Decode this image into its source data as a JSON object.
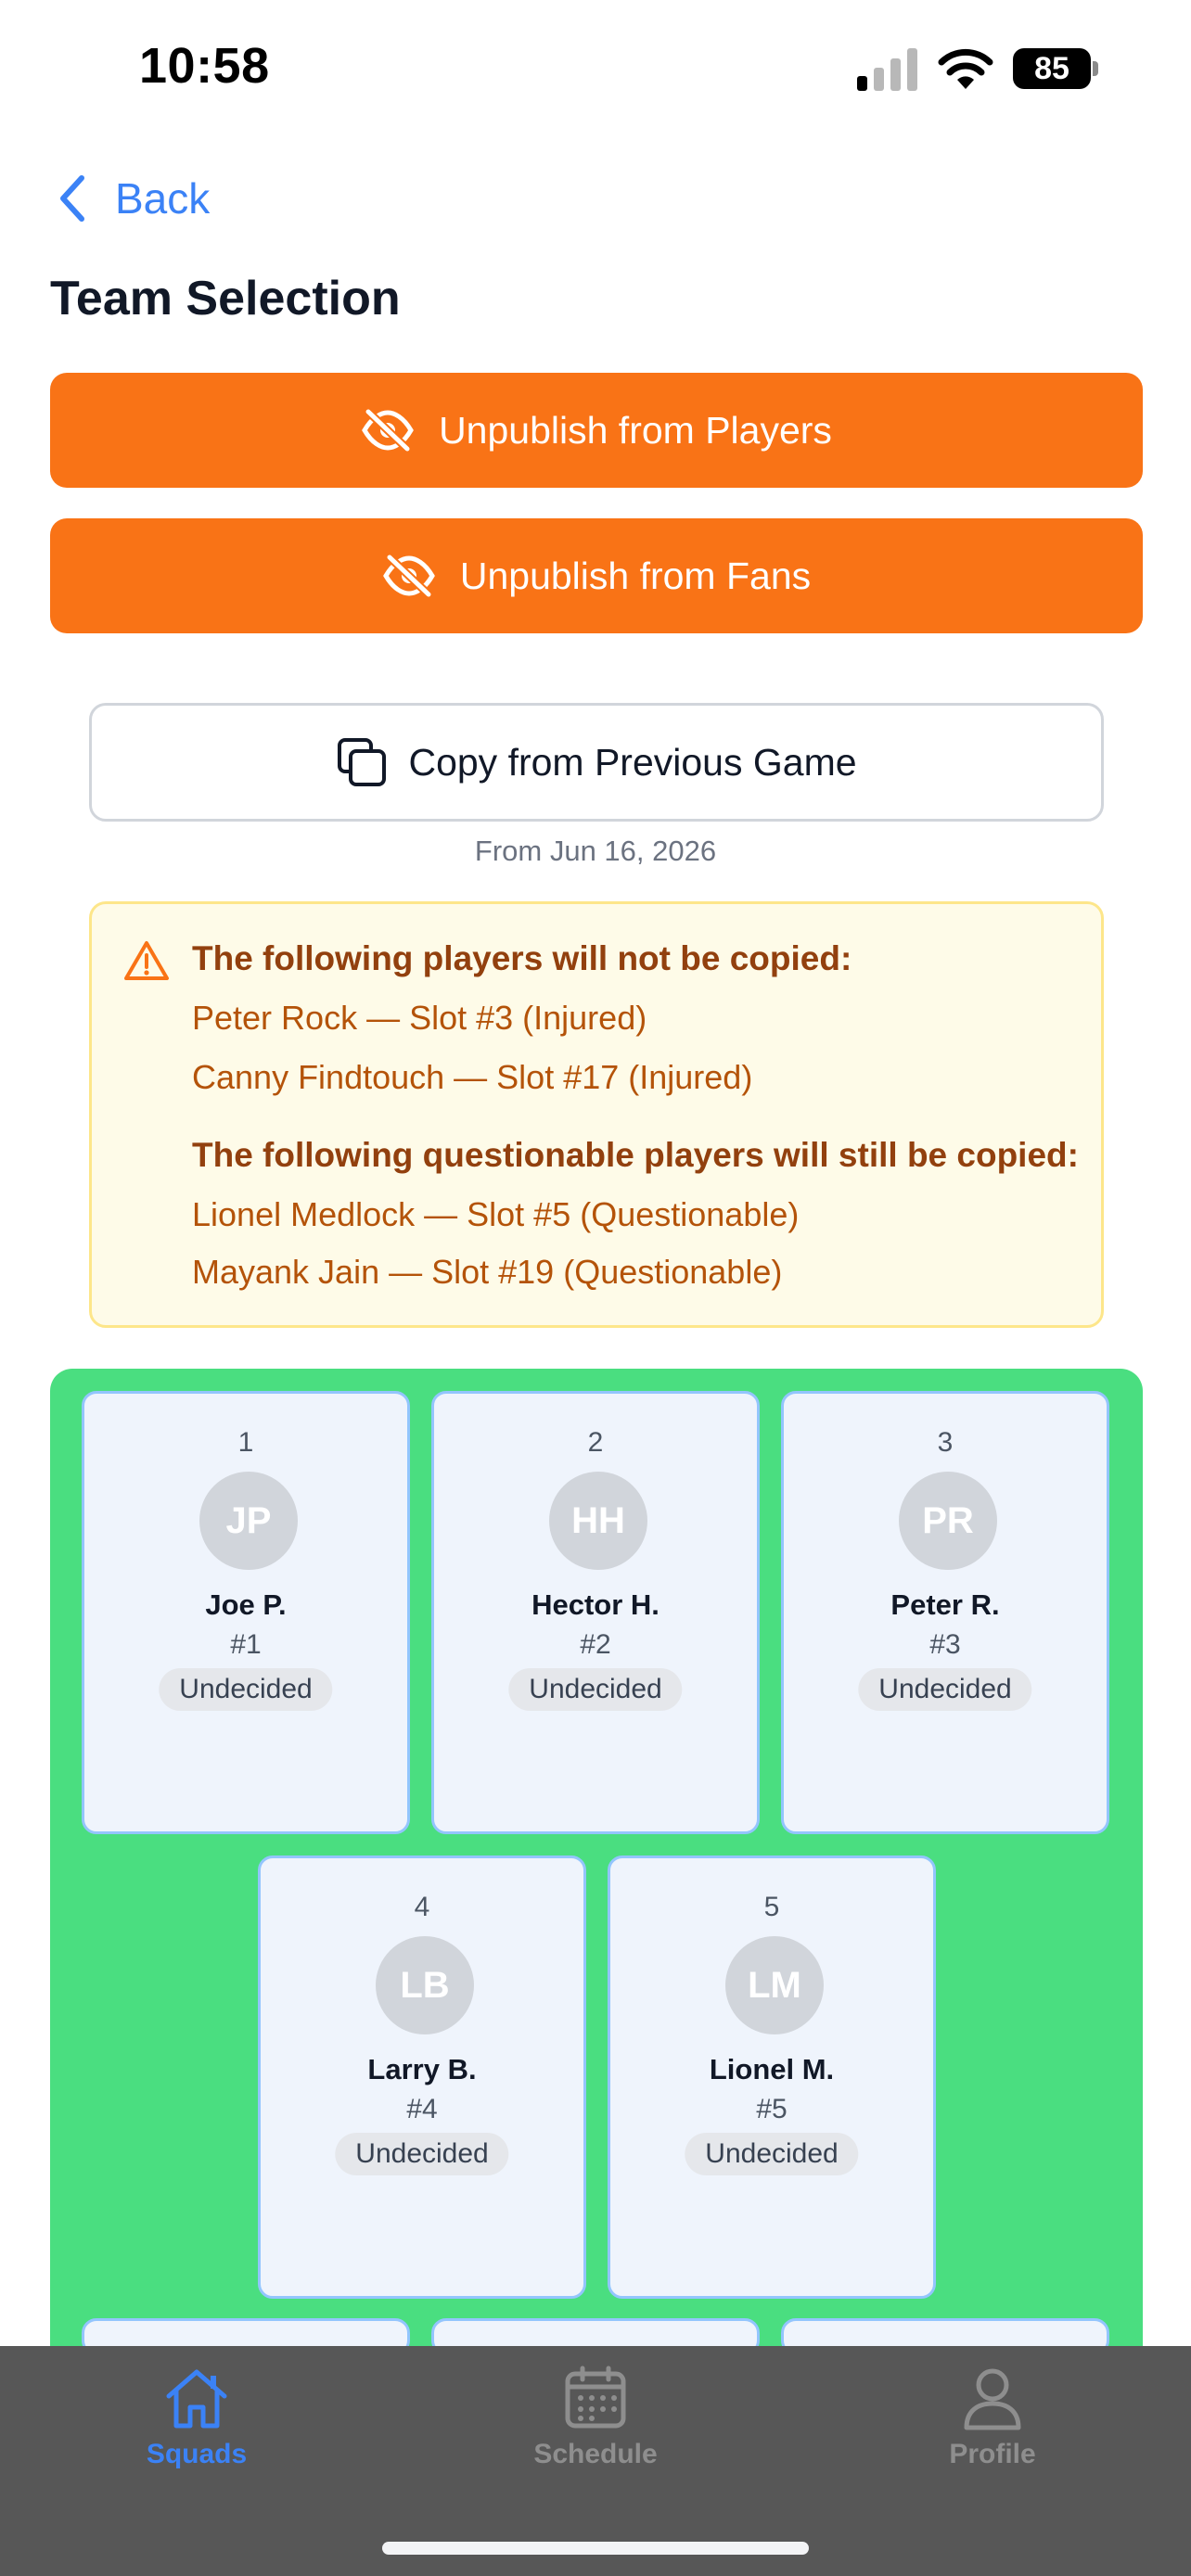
{
  "status_bar": {
    "time": "10:58",
    "battery": "85"
  },
  "header": {
    "back_label": "Back",
    "title": "Team Selection"
  },
  "actions": {
    "unpublish_players": "Unpublish from Players",
    "unpublish_fans": "Unpublish from Fans",
    "copy_previous": "Copy from Previous Game",
    "copy_date": "From Jun 16, 2026"
  },
  "warning": {
    "not_copied_title": "The following players will not be copied:",
    "not_copied": [
      "Peter Rock — Slot #3 (Injured)",
      "Canny Findtouch — Slot #17 (Injured)"
    ],
    "copied_title": "The following questionable players will still be copied:",
    "copied": [
      "Lionel Medlock — Slot #5 (Questionable)",
      "Mayank Jain — Slot #19 (Questionable)"
    ]
  },
  "slots": [
    {
      "slot": "1",
      "initials": "JP",
      "name": "Joe P.",
      "jersey": "#1",
      "status": "Undecided"
    },
    {
      "slot": "2",
      "initials": "HH",
      "name": "Hector H.",
      "jersey": "#2",
      "status": "Undecided"
    },
    {
      "slot": "3",
      "initials": "PR",
      "name": "Peter R.",
      "jersey": "#3",
      "status": "Undecided"
    },
    {
      "slot": "4",
      "initials": "LB",
      "name": "Larry B.",
      "jersey": "#4",
      "status": "Undecided"
    },
    {
      "slot": "5",
      "initials": "LM",
      "name": "Lionel M.",
      "jersey": "#5",
      "status": "Undecided"
    }
  ],
  "tabs": [
    {
      "label": "Squads",
      "icon": "home-icon",
      "active": true
    },
    {
      "label": "Schedule",
      "icon": "calendar-icon",
      "active": false
    },
    {
      "label": "Profile",
      "icon": "person-icon",
      "active": false
    }
  ],
  "colors": {
    "accent": "#3b82f6",
    "primary_button": "#f97316",
    "field": "#4ade80",
    "warning_bg": "#fefbe8"
  }
}
